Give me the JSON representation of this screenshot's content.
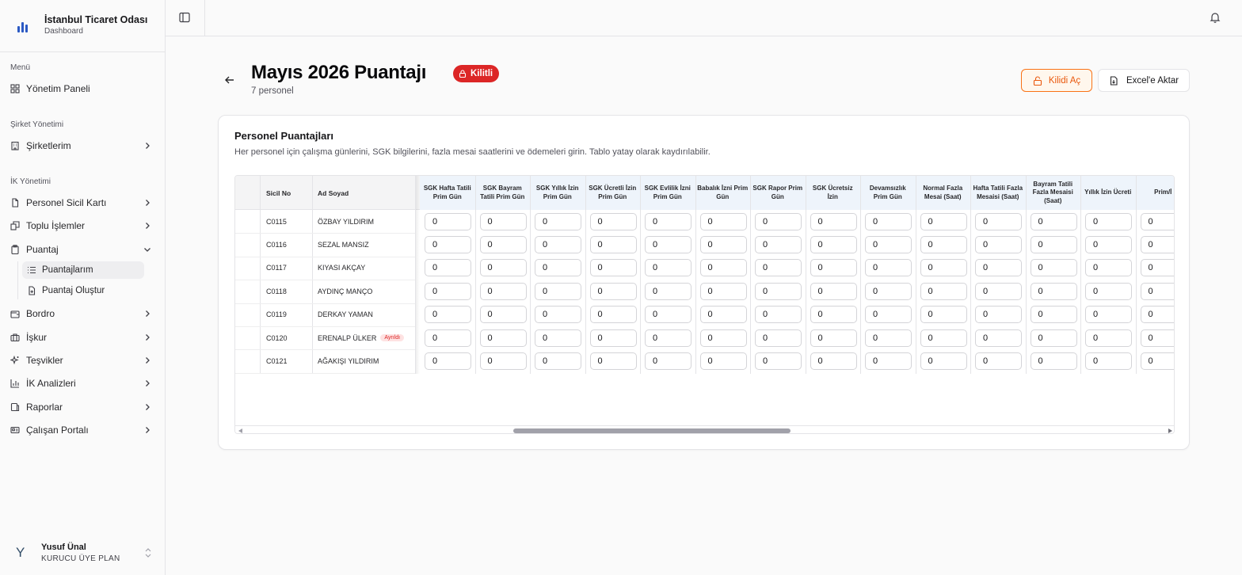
{
  "brand": {
    "name": "İstanbul Ticaret Odası",
    "subtitle": "Dashboard"
  },
  "sidebar": {
    "menu_title": "Menü",
    "dashboard": "Yönetim Paneli",
    "company_title": "Şirket Yönetimi",
    "companies": "Şirketlerim",
    "hr_title": "İK Yönetimi",
    "items": [
      {
        "label": "Personel Sicil Kartı",
        "icon": "file-icon"
      },
      {
        "label": "Toplu İşlemler",
        "icon": "layers-icon"
      },
      {
        "label": "Puantaj",
        "icon": "clipboard-icon"
      },
      {
        "label": "Bordro",
        "icon": "wallet-icon"
      },
      {
        "label": "İşkur",
        "icon": "briefcase-icon"
      },
      {
        "label": "Teşvikler",
        "icon": "sparkles-icon"
      },
      {
        "label": "İK Analizleri",
        "icon": "bar-chart-icon"
      },
      {
        "label": "Raporlar",
        "icon": "report-icon"
      },
      {
        "label": "Çalışan Portalı",
        "icon": "id-card-icon"
      }
    ],
    "sub_items": [
      {
        "label": "Puantajlarım",
        "icon": "list-icon",
        "active": true
      },
      {
        "label": "Puantaj Oluştur",
        "icon": "file-plus-icon",
        "active": false
      }
    ]
  },
  "user": {
    "initial": "Y",
    "name": "Yusuf Ünal",
    "plan": "KURUCU ÜYE PLAN"
  },
  "header": {
    "title": "Mayıs 2026 Puantajı",
    "status": "Kilitli",
    "count": "7 personel",
    "unlock_label": "Kilidi Aç",
    "export_label": "Excel'e Aktar"
  },
  "card": {
    "title": "Personel Puantajları",
    "description": "Her personel için çalışma günlerini, SGK bilgilerini, fazla mesai saatlerini ve ödemeleri girin. Tablo yatay olarak kaydırılabilir."
  },
  "table": {
    "headers": {
      "sicil": "Sicil No",
      "name": "Ad Soyad",
      "columns": [
        "SGK Hafta Tatili Prim Gün",
        "SGK Bayram Tatili Prim Gün",
        "SGK Yıllık İzin Prim Gün",
        "SGK Ücretli İzin Prim Gün",
        "SGK Evlilik İzni Prim Gün",
        "Babalık İzni Prim Gün",
        "SGK Rapor Prim Gün",
        "SGK Ücretsiz İzin",
        "Devamsızlık Prim Gün",
        "Normal Fazla Mesai (Saat)",
        "Hafta Tatili Fazla Mesaisi (Saat)",
        "Bayram Tatili Fazla Mesaisi (Saat)",
        "Yıllık İzin Ücreti",
        "Prim/İ"
      ]
    },
    "rows": [
      {
        "sicil": "C0115",
        "name": "ÖZBAY YILDIRIM",
        "tag": "",
        "values": [
          "0",
          "0",
          "0",
          "0",
          "0",
          "0",
          "0",
          "0",
          "0",
          "0",
          "0",
          "0",
          "0",
          "0"
        ]
      },
      {
        "sicil": "C0116",
        "name": "SEZAL MANSIZ",
        "tag": "",
        "values": [
          "0",
          "0",
          "0",
          "0",
          "0",
          "0",
          "0",
          "0",
          "0",
          "0",
          "0",
          "0",
          "0",
          "0"
        ]
      },
      {
        "sicil": "C0117",
        "name": "KIYASI AKÇAY",
        "tag": "",
        "values": [
          "0",
          "0",
          "0",
          "0",
          "0",
          "0",
          "0",
          "0",
          "0",
          "0",
          "0",
          "0",
          "0",
          "0"
        ]
      },
      {
        "sicil": "C0118",
        "name": "AYDINÇ MANÇO",
        "tag": "",
        "values": [
          "0",
          "0",
          "0",
          "0",
          "0",
          "0",
          "0",
          "0",
          "0",
          "0",
          "0",
          "0",
          "0",
          "0"
        ]
      },
      {
        "sicil": "C0119",
        "name": "DERKAY YAMAN",
        "tag": "",
        "values": [
          "0",
          "0",
          "0",
          "0",
          "0",
          "0",
          "0",
          "0",
          "0",
          "0",
          "0",
          "0",
          "0",
          "0"
        ]
      },
      {
        "sicil": "C0120",
        "name": "ERENALP ÜLKER",
        "tag": "Ayrıldı",
        "values": [
          "0",
          "0",
          "0",
          "0",
          "0",
          "0",
          "0",
          "0",
          "0",
          "0",
          "0",
          "0",
          "0",
          "0"
        ]
      },
      {
        "sicil": "C0121",
        "name": "AĞAKIŞI YILDIRIM",
        "tag": "",
        "values": [
          "0",
          "0",
          "0",
          "0",
          "0",
          "0",
          "0",
          "0",
          "0",
          "0",
          "0",
          "0",
          "0",
          "0"
        ]
      }
    ]
  },
  "colors": {
    "accent": "#dc2626",
    "unlock": "#ea580c",
    "brand": "#2b59c3",
    "header_blue": "#eef4fb"
  }
}
